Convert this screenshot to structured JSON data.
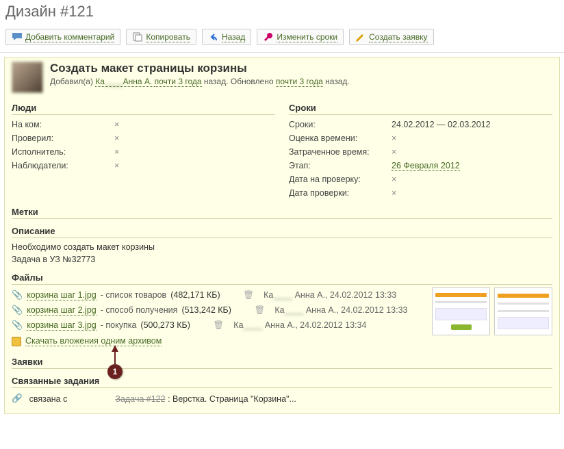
{
  "page_title": "Дизайн #121",
  "toolbar": {
    "add_comment": "Добавить комментарий",
    "copy": "Копировать",
    "back": "Назад",
    "change_dates": "Изменить сроки",
    "create_request": "Создать заявку"
  },
  "card": {
    "title": "Создать макет страницы корзины",
    "added_prefix": "Добавил(а)",
    "added_by_blur": "Ка______ Анна А.",
    "added_by_visible": "Анна А.",
    "time_ago": "почти 3 года",
    "ago_suffix": "назад.",
    "updated_prefix": "Обновлено",
    "updated_ago": "почти 3 года",
    "updated_suffix": "назад."
  },
  "sections": {
    "people": "Люди",
    "dates": "Сроки",
    "labels": "Метки",
    "description": "Описание",
    "files": "Файлы",
    "requests": "Заявки",
    "related": "Связанные задания"
  },
  "people": {
    "on_whom": {
      "label": "На ком:",
      "value": "×"
    },
    "checked": {
      "label": "Проверил:",
      "value": "×"
    },
    "executor": {
      "label": "Исполнитель:",
      "value": "×"
    },
    "watchers": {
      "label": "Наблюдатели:",
      "value": "×"
    }
  },
  "dates": {
    "range": {
      "label": "Сроки:",
      "value": "24.02.2012 — 02.03.2012"
    },
    "estimate": {
      "label": "Оценка времени:",
      "value": "×"
    },
    "spent": {
      "label": "Затраченное время:",
      "value": "×"
    },
    "stage": {
      "label": "Этап:",
      "value": "26 Февраля 2012"
    },
    "review_date": {
      "label": "Дата на проверку:",
      "value": "×"
    },
    "check_date": {
      "label": "Дата проверки:",
      "value": "×"
    }
  },
  "description": {
    "line1": "Необходимо создать макет корзины",
    "line2": "Задача в УЗ №32773"
  },
  "files": [
    {
      "name": "корзина шаг 1.jpg",
      "desc": "- список товаров",
      "size": "(482,171 КБ)",
      "meta_name": "Ка______ Анна А.",
      "meta_time": ", 24.02.2012 13:33"
    },
    {
      "name": "корзина шаг 2.jpg",
      "desc": "- способ получения",
      "size": "(513,242 КБ)",
      "meta_name": "Ка______ Анна А.",
      "meta_time": ", 24.02.2012 13:33"
    },
    {
      "name": "корзина шаг 3.jpg",
      "desc": "- покупка",
      "size": "(500,273 КБ)",
      "meta_name": "Ка______ Анна А.",
      "meta_time": ", 24.02.2012 13:34"
    }
  ],
  "download_all": "Скачать вложения одним архивом",
  "related": {
    "label": "связана с",
    "task": "Задача #122",
    "desc": ": Верстка. Страница \"Корзина\"..."
  },
  "annotation": {
    "number": "1"
  }
}
